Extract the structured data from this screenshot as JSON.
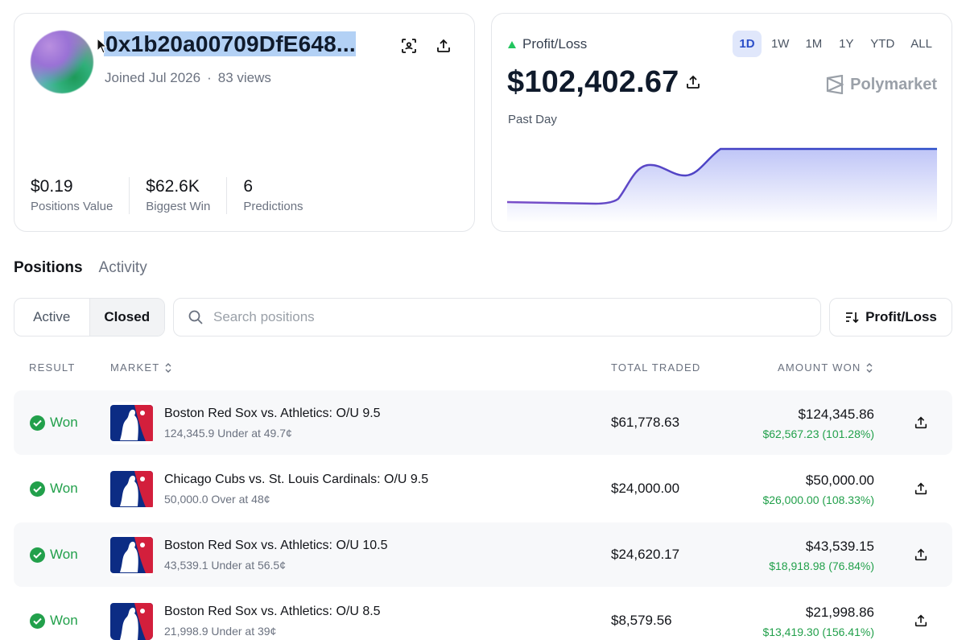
{
  "profile": {
    "address": "0x1b20a00709DfE648...",
    "joined": "Joined Jul 2026",
    "views": "83 views",
    "stats": [
      {
        "value": "$0.19",
        "label": "Positions Value"
      },
      {
        "value": "$62.6K",
        "label": "Biggest Win"
      },
      {
        "value": "6",
        "label": "Predictions"
      }
    ]
  },
  "pnl": {
    "label": "Profit/Loss",
    "value": "$102,402.67",
    "period_label": "Past Day",
    "brand": "Polymarket",
    "ranges": [
      "1D",
      "1W",
      "1M",
      "1Y",
      "YTD",
      "ALL"
    ],
    "active_range": "1D",
    "colors": {
      "up": "#22c55e",
      "line_start": "#7b4fc9",
      "line_end": "#2b4fc9"
    }
  },
  "tabs": [
    "Positions",
    "Activity"
  ],
  "filters": {
    "segments": [
      "Active",
      "Closed"
    ],
    "active_segment": "Closed",
    "search_placeholder": "Search positions",
    "sort_label": "Profit/Loss"
  },
  "table": {
    "headers": {
      "result": "RESULT",
      "market": "MARKET",
      "total_traded": "TOTAL TRADED",
      "amount_won": "AMOUNT WON"
    },
    "rows": [
      {
        "result": "Won",
        "market": "Boston Red Sox vs. Athletics: O/U 9.5",
        "detail": "124,345.9 Under at 49.7¢",
        "traded": "$61,778.63",
        "amount": "$124,345.86",
        "gain": "$62,567.23 (101.28%)"
      },
      {
        "result": "Won",
        "market": "Chicago Cubs vs. St. Louis Cardinals: O/U 9.5",
        "detail": "50,000.0 Over at 48¢",
        "traded": "$24,000.00",
        "amount": "$50,000.00",
        "gain": "$26,000.00 (108.33%)"
      },
      {
        "result": "Won",
        "market": "Boston Red Sox vs. Athletics: O/U 10.5",
        "detail": "43,539.1 Under at 56.5¢",
        "traded": "$24,620.17",
        "amount": "$43,539.15",
        "gain": "$18,918.98 (76.84%)"
      },
      {
        "result": "Won",
        "market": "Boston Red Sox vs. Athletics: O/U 8.5",
        "detail": "21,998.9 Under at 39¢",
        "traded": "$8,579.56",
        "amount": "$21,998.86",
        "gain": "$13,419.30 (156.41%)"
      }
    ]
  }
}
